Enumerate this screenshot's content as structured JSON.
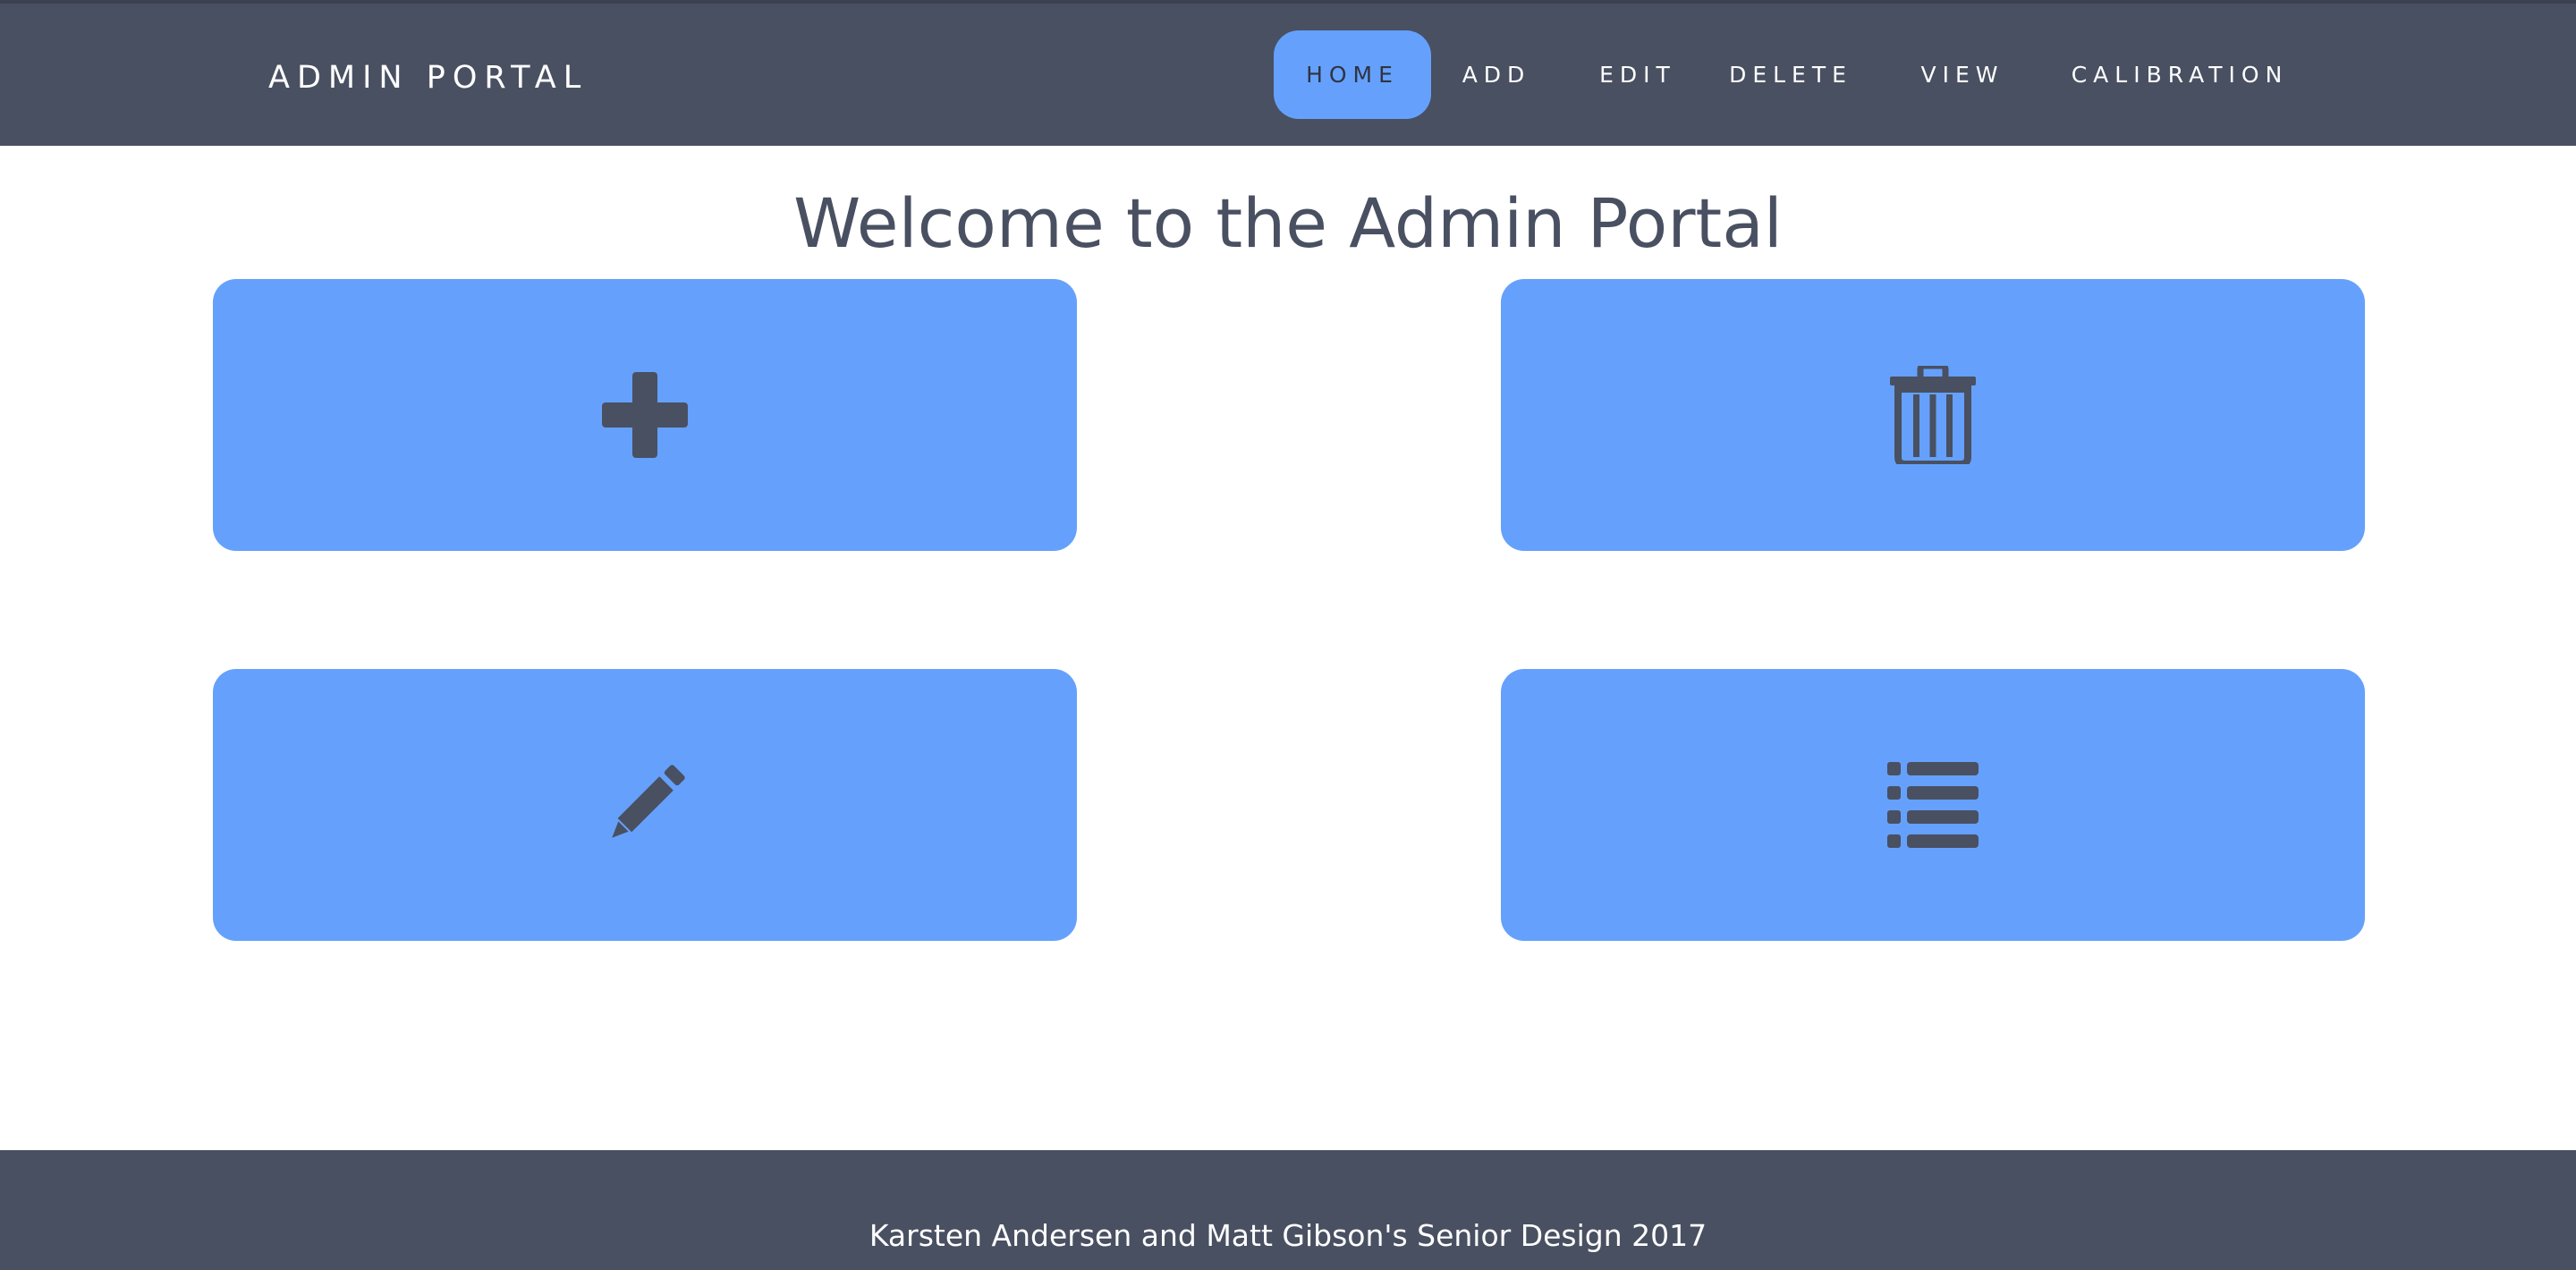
{
  "brand": {
    "title": "ADMIN PORTAL"
  },
  "nav": {
    "items": [
      {
        "label": "HOME",
        "active": true
      },
      {
        "label": "ADD"
      },
      {
        "label": "EDIT"
      },
      {
        "label": "DELETE"
      },
      {
        "label": "VIEW"
      },
      {
        "label": "CALIBRATION"
      }
    ]
  },
  "main": {
    "title": "Welcome to the Admin Portal",
    "tiles": [
      {
        "icon": "plus-icon"
      },
      {
        "icon": "trash-icon"
      },
      {
        "icon": "pencil-icon"
      },
      {
        "icon": "list-icon"
      }
    ]
  },
  "footer": {
    "text": "Karsten Andersen and Matt Gibson's Senior Design 2017"
  },
  "colors": {
    "navbar": "#495061",
    "accent": "#65a1fc",
    "icon": "#495061",
    "title_text": "#495061"
  }
}
